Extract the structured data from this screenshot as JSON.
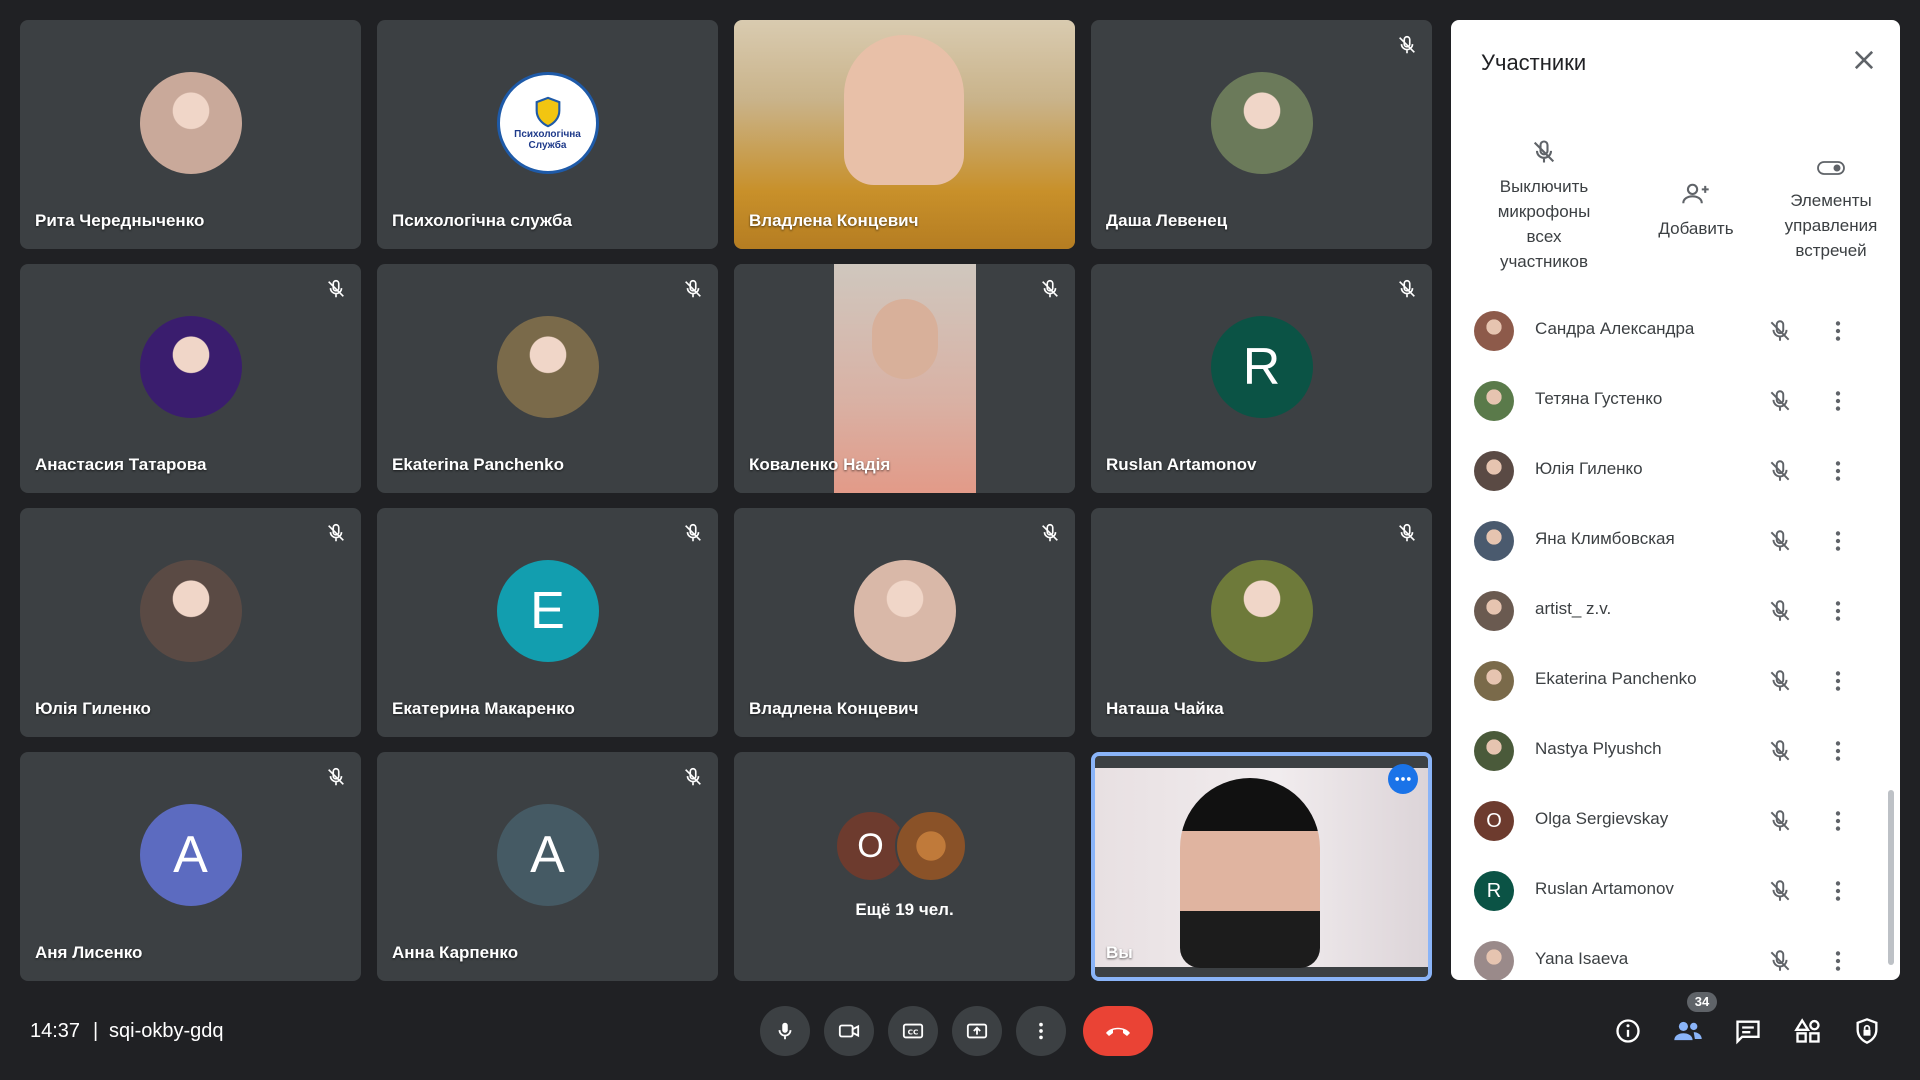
{
  "tiles": [
    {
      "name": "Рита Чередныченко",
      "type": "avatar-photo",
      "muted": false,
      "avatar_color": "#c9a99a"
    },
    {
      "name": "Психологічна служба",
      "type": "avatar-logo",
      "muted": false,
      "logo_text": "Психологічна Служба"
    },
    {
      "name": "Владлена Концевич",
      "type": "video",
      "muted": false
    },
    {
      "name": "Даша Левенец",
      "type": "avatar-photo",
      "muted": true,
      "avatar_color": "#6b7a5a"
    },
    {
      "name": "Анастасия Татарова",
      "type": "avatar-photo",
      "muted": true,
      "avatar_color": "#3a1d6e"
    },
    {
      "name": "Ekaterina Panchenko",
      "type": "avatar-photo",
      "muted": true,
      "avatar_color": "#7a6a4a"
    },
    {
      "name": "Коваленко Надія",
      "type": "video-portrait",
      "muted": true
    },
    {
      "name": "Ruslan Artamonov",
      "type": "avatar-letter",
      "muted": true,
      "letter": "R",
      "avatar_color": "#0b5345"
    },
    {
      "name": "Юлія Гиленко",
      "type": "avatar-photo",
      "muted": true,
      "avatar_color": "#5a4a44"
    },
    {
      "name": "Екатерина Макаренко",
      "type": "avatar-letter",
      "muted": true,
      "letter": "E",
      "avatar_color": "#129eaf"
    },
    {
      "name": "Владлена Концевич",
      "type": "avatar-photo",
      "muted": true,
      "avatar_color": "#d9b8a8"
    },
    {
      "name": "Наташа Чайка",
      "type": "avatar-photo",
      "muted": true,
      "avatar_color": "#6e7a3a"
    },
    {
      "name": "Аня Лисенко",
      "type": "avatar-letter",
      "muted": true,
      "letter": "A",
      "avatar_color": "#5c6bc0"
    },
    {
      "name": "Анна Карпенко",
      "type": "avatar-letter",
      "muted": true,
      "letter": "A",
      "avatar_color": "#455a64"
    },
    {
      "name": "",
      "type": "more",
      "muted": false,
      "more_label": "Ещё 19 чел.",
      "more_letter": "O",
      "more_color": "#6d3b2e"
    },
    {
      "name": "Вы",
      "type": "self",
      "muted": false
    }
  ],
  "panel": {
    "title": "Участники",
    "actions": [
      {
        "label_lines": [
          "Выключить",
          "микрофоны",
          "всех",
          "участников"
        ],
        "icon": "mic-off-icon"
      },
      {
        "label_lines": [
          "Добавить"
        ],
        "icon": "add-person-icon"
      },
      {
        "label_lines": [
          "Элементы",
          "управления",
          "встречей"
        ],
        "icon": "toggle-icon"
      }
    ],
    "participants": [
      {
        "name": "Сандра Александра",
        "avatar_color": "#8d5a4a",
        "letter": ""
      },
      {
        "name": "Тетяна Густенко",
        "avatar_color": "#5a7a4a",
        "letter": ""
      },
      {
        "name": "Юлія Гиленко",
        "avatar_color": "#5a4a44",
        "letter": ""
      },
      {
        "name": "Яна Климбовская",
        "avatar_color": "#4a5a6e",
        "letter": ""
      },
      {
        "name": "artist_ z.v.",
        "avatar_color": "#6a5a50",
        "letter": ""
      },
      {
        "name": "Ekaterina Panchenko",
        "avatar_color": "#7a6a4a",
        "letter": ""
      },
      {
        "name": "Nastya Plyushch",
        "avatar_color": "#4a5a3a",
        "letter": ""
      },
      {
        "name": "Olga Sergievskay",
        "avatar_color": "#6d3b2e",
        "letter": "O"
      },
      {
        "name": "Ruslan Artamonov",
        "avatar_color": "#0b5345",
        "letter": "R"
      },
      {
        "name": "Yana Isaeva",
        "avatar_color": "#9a8a8a",
        "letter": ""
      }
    ]
  },
  "bottom": {
    "time": "14:37",
    "separator": "|",
    "meeting_code": "sqi-okby-gdq",
    "participants_badge": "34"
  },
  "colors": {
    "accent": "#1a73e8",
    "end_call": "#ea4335",
    "tile_bg": "#3c4043",
    "page_bg": "#202124"
  }
}
